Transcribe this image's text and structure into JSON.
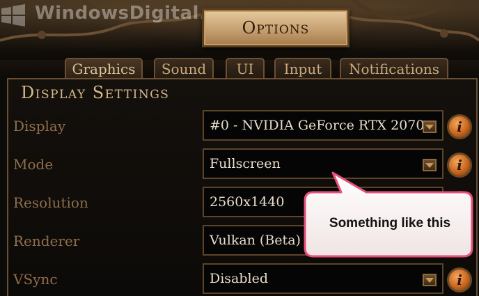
{
  "watermark": "WindowsDigital.com",
  "header": {
    "title": "Options"
  },
  "tabs": [
    {
      "label": "Graphics",
      "active": true
    },
    {
      "label": "Sound",
      "active": false
    },
    {
      "label": "UI",
      "active": false
    },
    {
      "label": "Input",
      "active": false
    },
    {
      "label": "Notifications",
      "active": false
    }
  ],
  "section": {
    "title": "Display Settings"
  },
  "settings": [
    {
      "label": "Display",
      "value": "#0 - NVIDIA GeForce RTX 2070"
    },
    {
      "label": "Mode",
      "value": "Fullscreen"
    },
    {
      "label": "Resolution",
      "value": "2560x1440"
    },
    {
      "label": "Renderer",
      "value": "Vulkan (Beta)"
    },
    {
      "label": "VSync",
      "value": "Disabled"
    }
  ],
  "callout": {
    "text": "Something like this",
    "border_color": "#e6507a"
  },
  "colors": {
    "label": "#8f6e4a",
    "value": "#e9dccb",
    "accent": "#d7b98d",
    "info": "#c9661d"
  },
  "icons": {
    "dropdown": "chevron-down-icon",
    "info": "info-icon"
  }
}
